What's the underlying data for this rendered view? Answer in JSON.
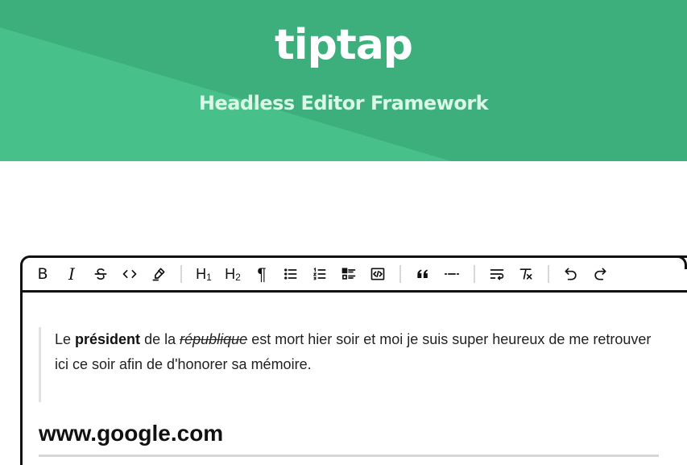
{
  "hero": {
    "title": "tiptap",
    "subtitle": "Headless Editor Framework",
    "colors": {
      "base": "#3daf7c",
      "light": "#47c189",
      "subtitle": "#dbf7e7"
    }
  },
  "toolbar": {
    "groups": [
      [
        {
          "name": "bold",
          "label": "B",
          "icon": "bold-icon"
        },
        {
          "name": "italic",
          "label": "I",
          "icon": "italic-icon"
        },
        {
          "name": "strike",
          "icon": "strikethrough-icon"
        },
        {
          "name": "code",
          "icon": "code-icon"
        },
        {
          "name": "highlight",
          "icon": "highlighter-icon"
        }
      ],
      [
        {
          "name": "h1",
          "label": "H1",
          "icon": "heading-1-icon"
        },
        {
          "name": "h2",
          "label": "H2",
          "icon": "heading-2-icon"
        },
        {
          "name": "paragraph",
          "label": "¶",
          "icon": "paragraph-icon"
        },
        {
          "name": "bullet-list",
          "icon": "bullet-list-icon"
        },
        {
          "name": "ordered-list",
          "icon": "ordered-list-icon"
        },
        {
          "name": "task-list",
          "icon": "task-list-icon"
        },
        {
          "name": "code-block",
          "icon": "code-block-icon"
        }
      ],
      [
        {
          "name": "blockquote",
          "label": "❝",
          "icon": "quote-icon"
        },
        {
          "name": "horizontal-rule",
          "icon": "horizontal-rule-icon"
        }
      ],
      [
        {
          "name": "hard-break",
          "icon": "text-wrap-icon"
        },
        {
          "name": "clear-format",
          "icon": "clear-format-icon"
        }
      ],
      [
        {
          "name": "undo",
          "icon": "undo-icon"
        },
        {
          "name": "redo",
          "icon": "redo-icon"
        }
      ]
    ]
  },
  "content": {
    "blockquote": {
      "prefix": "Le ",
      "bold": "président",
      "middle": " de la ",
      "strike": "république",
      "suffix": " est mort hier soir et moi je suis super heureux de me retrouver ici ce soir afin de d'honorer sa mémoire."
    },
    "heading": "www.google.com"
  }
}
